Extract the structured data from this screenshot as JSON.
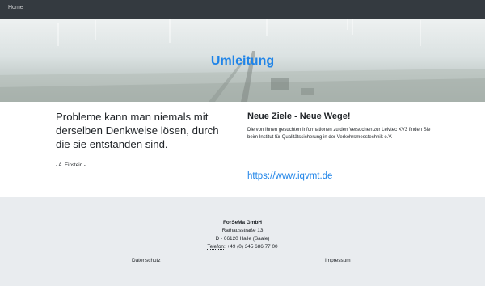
{
  "nav": {
    "home_label": "Home"
  },
  "hero": {
    "title": "Umleitung"
  },
  "quote": {
    "text": "Probleme kann man niemals mit derselben Denkweise lösen, durch die sie entstanden sind.",
    "author": "- A. Einstein -"
  },
  "news": {
    "title": "Neue Ziele - Neue Wege!",
    "text": "Die von Ihnen gesuchten Informationen zu den Versuchen zur Leivtec XV3 finden Sie beim Institut für Qualitätssicherung in der Verkehrsmesstechnik e.V.",
    "link": "https://www.iqvmt.de"
  },
  "footer": {
    "company": "ForSeMa GmbH",
    "street": "Rathausstraße 13",
    "city": "D - 06120 Halle (Saale)",
    "phone_label": "Telefon:",
    "phone": " +49 (0) 345 686 77 00",
    "privacy_label": "Datenschutz",
    "imprint_label": "Impressum"
  },
  "colors": {
    "navbar": "#343a40",
    "accent": "#1f84e8",
    "footer_bg": "#e9ecef"
  }
}
